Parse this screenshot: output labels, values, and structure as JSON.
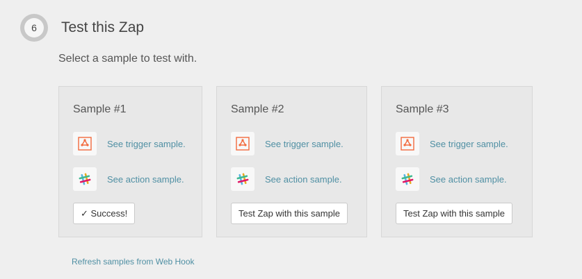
{
  "step": {
    "number": "6",
    "title": "Test this Zap"
  },
  "subtitle": "Select a sample to test with.",
  "samples": [
    {
      "title": "Sample #1",
      "trigger_link": "See trigger sample.",
      "action_link": "See action sample.",
      "button_label": "✓ Success!",
      "trigger_icon": "webhook-icon",
      "action_icon": "slack-icon"
    },
    {
      "title": "Sample #2",
      "trigger_link": "See trigger sample.",
      "action_link": "See action sample.",
      "button_label": "Test Zap with this sample",
      "trigger_icon": "webhook-icon",
      "action_icon": "slack-icon"
    },
    {
      "title": "Sample #3",
      "trigger_link": "See trigger sample.",
      "action_link": "See action sample.",
      "button_label": "Test Zap with this sample",
      "trigger_icon": "webhook-icon",
      "action_icon": "slack-icon"
    }
  ],
  "refresh_link": "Refresh samples from Web Hook",
  "colors": {
    "link": "#4f8fa3",
    "webhook": "#f26a3d",
    "slack_green": "#3eb890",
    "slack_blue": "#58b5e3",
    "slack_red": "#e01765",
    "slack_yellow": "#e9a820"
  }
}
